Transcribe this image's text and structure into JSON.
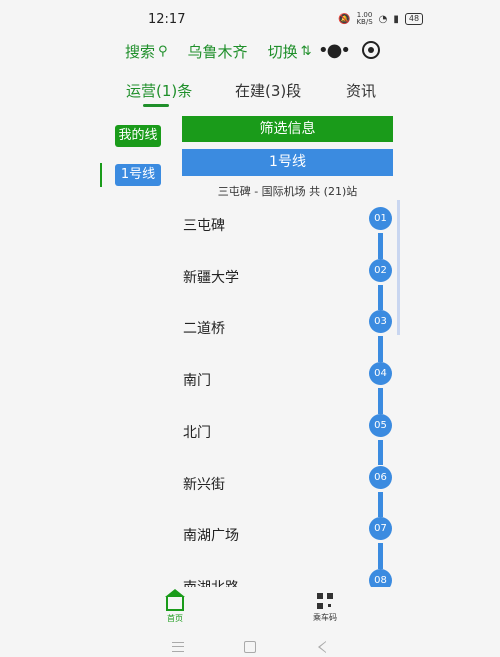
{
  "status": {
    "time": "12:17",
    "net_speed_value": "1.00",
    "net_speed_unit": "KB/S",
    "battery": "48",
    "icons": [
      "silent-icon",
      "nfc-icon",
      "wifi-icon",
      "signal-icon",
      "battery-icon"
    ]
  },
  "nav": {
    "search": "搜索",
    "city": "乌鲁木齐",
    "switch": "切换",
    "search_icon": "search-icon",
    "switch_icon": "swap-icon"
  },
  "tabs": [
    {
      "label": "运营(1)条",
      "active": true
    },
    {
      "label": "在建(3)段",
      "active": false
    },
    {
      "label": "资讯",
      "active": false
    }
  ],
  "sidebar": {
    "my_lines": "我的线",
    "line1": "1号线"
  },
  "filter_label": "筛选信息",
  "line": {
    "name": "1号线",
    "route": "三屯碑 - 国际机场 共 (21)站",
    "color": "#3b8be0"
  },
  "stations": [
    {
      "num": "01",
      "name": "三屯碑"
    },
    {
      "num": "02",
      "name": "新疆大学"
    },
    {
      "num": "03",
      "name": "二道桥"
    },
    {
      "num": "04",
      "name": "南门"
    },
    {
      "num": "05",
      "name": "北门"
    },
    {
      "num": "06",
      "name": "新兴街"
    },
    {
      "num": "07",
      "name": "南湖广场"
    },
    {
      "num": "08",
      "name": "南湖北路"
    }
  ],
  "bottom_nav": {
    "home": "首页",
    "ride_code": "乘车码"
  },
  "colors": {
    "brand_green": "#1a9b1a",
    "accent_blue": "#3b8be0"
  }
}
